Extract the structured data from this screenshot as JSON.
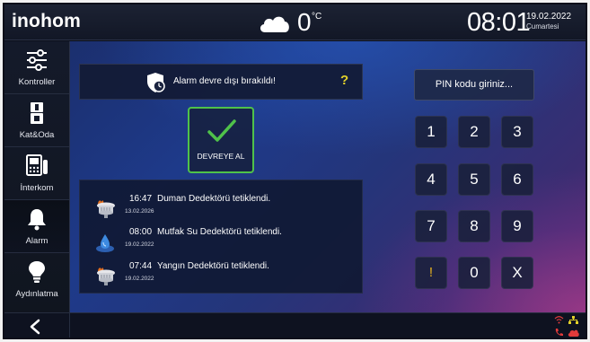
{
  "app": {
    "brand": "inohom"
  },
  "weather": {
    "temperature": "0",
    "unit": "°C",
    "icon": "cloud-icon"
  },
  "clock": {
    "time": "08:01",
    "date": "19.02.2022",
    "day": "Cumartesi"
  },
  "sidebar": {
    "items": [
      {
        "label": "Kontroller",
        "icon": "sliders-icon",
        "active": false
      },
      {
        "label": "Kat&Oda",
        "icon": "floor-room-icon",
        "active": false
      },
      {
        "label": "İnterkom",
        "icon": "intercom-icon",
        "active": false
      },
      {
        "label": "Alarm",
        "icon": "bell-icon",
        "active": true
      },
      {
        "label": "Aydınlatma",
        "icon": "bulb-icon",
        "active": false
      }
    ]
  },
  "alarm": {
    "status_text": "Alarm devre dışı bırakıldı!",
    "help_label": "?",
    "arm_button_label": "DEVREYE AL",
    "colors": {
      "arm_border": "#4fc24a",
      "help": "#e3d22a"
    }
  },
  "events": [
    {
      "time": "16:47",
      "message": "Duman Dedektörü tetiklendi.",
      "date": "13.02.2026",
      "icon": "smoke-detector-fire-icon"
    },
    {
      "time": "08:00",
      "message": "Mutfak Su Dedektörü tetiklendi.",
      "date": "19.02.2022",
      "icon": "water-drop-icon"
    },
    {
      "time": "07:44",
      "message": "Yangın Dedektörü tetiklendi.",
      "date": "19.02.2022",
      "icon": "smoke-detector-fire-icon"
    }
  ],
  "keypad": {
    "placeholder": "PIN kodu giriniz...",
    "keys": [
      "1",
      "2",
      "3",
      "4",
      "5",
      "6",
      "7",
      "8",
      "9",
      "!",
      "0",
      "X"
    ]
  },
  "status_bar": {
    "icons": [
      "wifi-icon",
      "network-icon",
      "phone-icon",
      "cloud-alert-icon"
    ]
  }
}
